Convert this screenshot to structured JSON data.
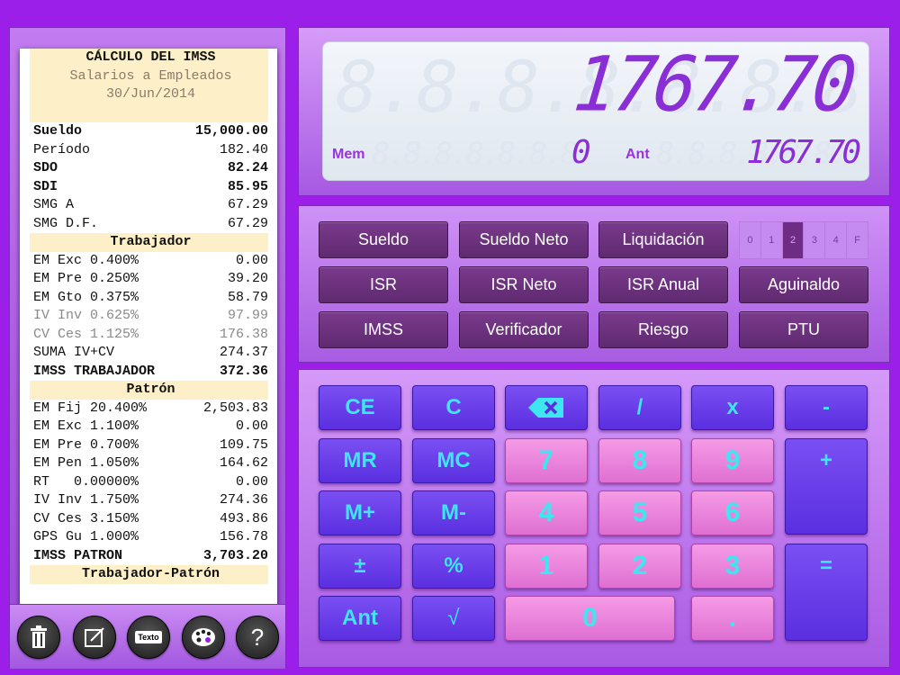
{
  "tape": {
    "header": [
      "CÁLCULO DEL IMSS",
      "Salarios a Empleados",
      "30/Jun/2014"
    ],
    "lines": [
      {
        "label": "Sueldo",
        "value": "15,000.00",
        "style": "bold"
      },
      {
        "label": "Período",
        "value": "182.40",
        "style": ""
      },
      {
        "label": "SDO",
        "value": "82.24",
        "style": "bold"
      },
      {
        "label": "SDI",
        "value": "85.95",
        "style": "bold"
      },
      {
        "label": "SMG A",
        "value": "67.29",
        "style": ""
      },
      {
        "label": "SMG D.F.",
        "value": "67.29",
        "style": ""
      },
      {
        "label": "Trabajador",
        "value": "",
        "style": "section"
      },
      {
        "label": "EM Exc 0.400%",
        "value": "0.00",
        "style": ""
      },
      {
        "label": "EM Pre 0.250%",
        "value": "39.20",
        "style": ""
      },
      {
        "label": "EM Gto 0.375%",
        "value": "58.79",
        "style": ""
      },
      {
        "label": "IV Inv 0.625%",
        "value": "97.99",
        "style": "grey"
      },
      {
        "label": "CV Ces 1.125%",
        "value": "176.38",
        "style": "grey"
      },
      {
        "label": "SUMA IV+CV",
        "value": "274.37",
        "style": ""
      },
      {
        "label": "IMSS TRABAJADOR",
        "value": "372.36",
        "style": "bold"
      },
      {
        "label": "Patrón",
        "value": "",
        "style": "section"
      },
      {
        "label": "EM Fij 20.400%",
        "value": "2,503.83",
        "style": ""
      },
      {
        "label": "EM Exc 1.100%",
        "value": "0.00",
        "style": ""
      },
      {
        "label": "EM Pre 0.700%",
        "value": "109.75",
        "style": ""
      },
      {
        "label": "EM Pen 1.050%",
        "value": "164.62",
        "style": ""
      },
      {
        "label": "RT   0.00000%",
        "value": "0.00",
        "style": ""
      },
      {
        "label": "IV Inv 1.750%",
        "value": "274.36",
        "style": ""
      },
      {
        "label": "CV Ces 3.150%",
        "value": "493.86",
        "style": ""
      },
      {
        "label": "GPS Gu 1.000%",
        "value": "156.78",
        "style": ""
      },
      {
        "label": "IMSS PATRON",
        "value": "3,703.20",
        "style": "bold"
      },
      {
        "label": "Trabajador-Patrón",
        "value": "",
        "style": "section"
      }
    ]
  },
  "toolbar": {
    "text_icon_label": "Texto",
    "help_label": "?"
  },
  "display": {
    "main_value": "1767.70",
    "ghost_main": "8.8.8.8.8.8.8.8.8.8.8.",
    "mem_label": "Mem",
    "mem_value": "0",
    "ant_label": "Ant",
    "ant_value": "1767.70",
    "ghost_small": "8.8.8.8.8.8.8.8.8.8.8.8.8.8."
  },
  "functions": {
    "row1": [
      "Sueldo",
      "Sueldo Neto",
      "Liquidación"
    ],
    "row2": [
      "ISR",
      "ISR Neto",
      "ISR Anual",
      "Aguinaldo"
    ],
    "row3": [
      "IMSS",
      "Verificador",
      "Riesgo",
      "PTU"
    ],
    "decimals": [
      "0",
      "1",
      "2",
      "3",
      "4",
      "F"
    ],
    "selected_decimal": "2"
  },
  "keys": {
    "ce": "CE",
    "c": "C",
    "divide": "/",
    "multiply": "x",
    "minus": "-",
    "mr": "MR",
    "mc": "MC",
    "mplus": "M+",
    "mminus": "M-",
    "plusminus": "±",
    "percent": "%",
    "ant": "Ant",
    "sqrt": "√",
    "plus": "+",
    "equals": "=",
    "dot": ".",
    "d7": "7",
    "d8": "8",
    "d9": "9",
    "d4": "4",
    "d5": "5",
    "d6": "6",
    "d1": "1",
    "d2": "2",
    "d3": "3",
    "d0": "0"
  },
  "colors": {
    "background": "#9b1fe8",
    "lcd_digits": "#8a2fd6",
    "key_text": "#3ee6f0",
    "function_button": "#6e2f80"
  }
}
